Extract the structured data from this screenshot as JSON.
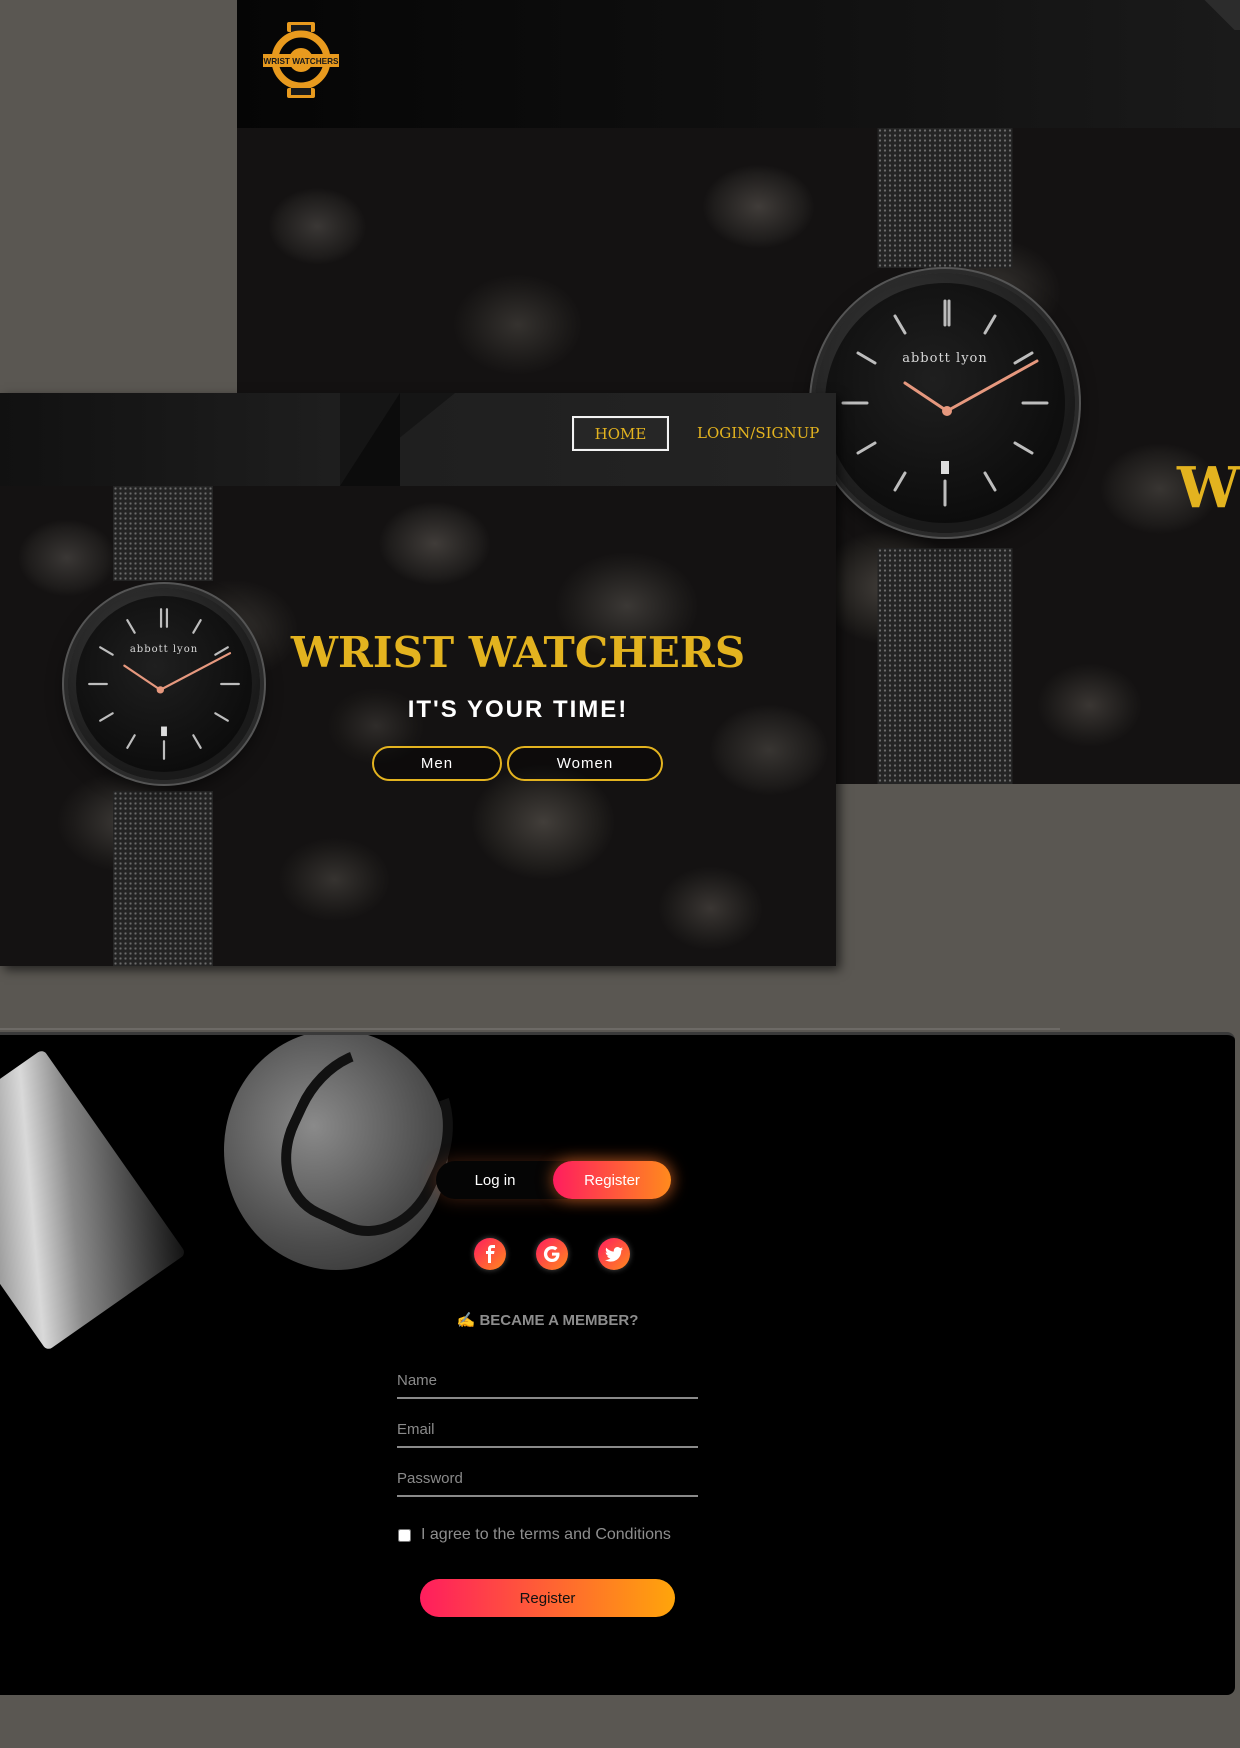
{
  "brand": {
    "logo_text": "WRIST WATCHERS",
    "accent_color": "#e3b31f"
  },
  "back_screen": {
    "hero_title_partial": "W",
    "watch_brand": "abbott lyon"
  },
  "front_screen": {
    "nav": {
      "home_label": "HOME",
      "login_label": "LOGIN/SIGNUP"
    },
    "hero": {
      "title": "WRIST WATCHERS",
      "tagline": "IT'S YOUR TIME!",
      "men_label": "Men",
      "women_label": "Women",
      "watch_brand": "abbott lyon"
    }
  },
  "register_panel": {
    "toggle": {
      "login_label": "Log in",
      "register_label": "Register"
    },
    "social": [
      {
        "name": "facebook",
        "icon": "facebook-icon"
      },
      {
        "name": "google",
        "icon": "google-icon"
      },
      {
        "name": "twitter",
        "icon": "twitter-icon"
      }
    ],
    "member_heading": "✍ BECAME A MEMBER?",
    "fields": {
      "name_placeholder": "Name",
      "email_placeholder": "Email",
      "password_placeholder": "Password"
    },
    "agree_text": "I agree to the terms and Conditions",
    "submit_label": "Register",
    "gradient": [
      "#ff1d5e",
      "#ff8a1d"
    ]
  }
}
